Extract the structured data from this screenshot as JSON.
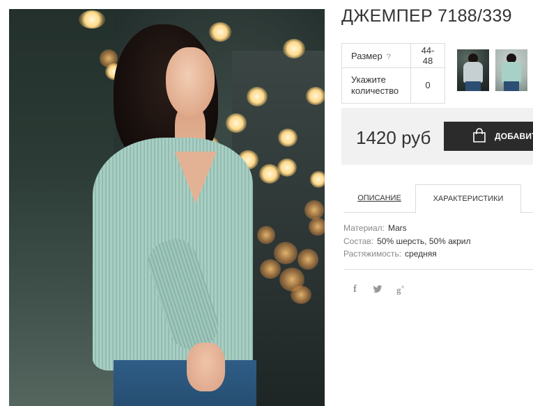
{
  "product": {
    "title": "ДЖЕМПЕР 7188/339"
  },
  "specs": [
    {
      "label": "Размер",
      "help": "?",
      "value": "44-48"
    },
    {
      "label": "Укажите количество",
      "value": "0"
    }
  ],
  "thumbnails": [
    {
      "name": "thumbnail-1"
    },
    {
      "name": "thumbnail-2"
    }
  ],
  "price": {
    "text": "1420 руб",
    "buy_label": "ДОБАВИТЬ",
    "buy_icon": "shopping-bag-icon"
  },
  "tabs": [
    {
      "label": "ОПИСАНИЕ",
      "active": false
    },
    {
      "label": "ХАРАКТЕРИСТИКИ",
      "active": true
    }
  ],
  "characteristics": [
    {
      "key": "Материал:",
      "value": "Mars"
    },
    {
      "key": "Состав:",
      "value": "50% шерсть, 50% акрил"
    },
    {
      "key": "Растяжимость:",
      "value": "средняя"
    }
  ],
  "social": [
    {
      "icon": "facebook-icon",
      "glyph": "f"
    },
    {
      "icon": "twitter-icon",
      "glyph": "🐦"
    },
    {
      "icon": "google-plus-icon",
      "glyph": "g+"
    }
  ],
  "colors": {
    "button_bg": "#2b2b2b",
    "price_bg": "#f1f1f1",
    "sweater": "#a9cfc4"
  }
}
